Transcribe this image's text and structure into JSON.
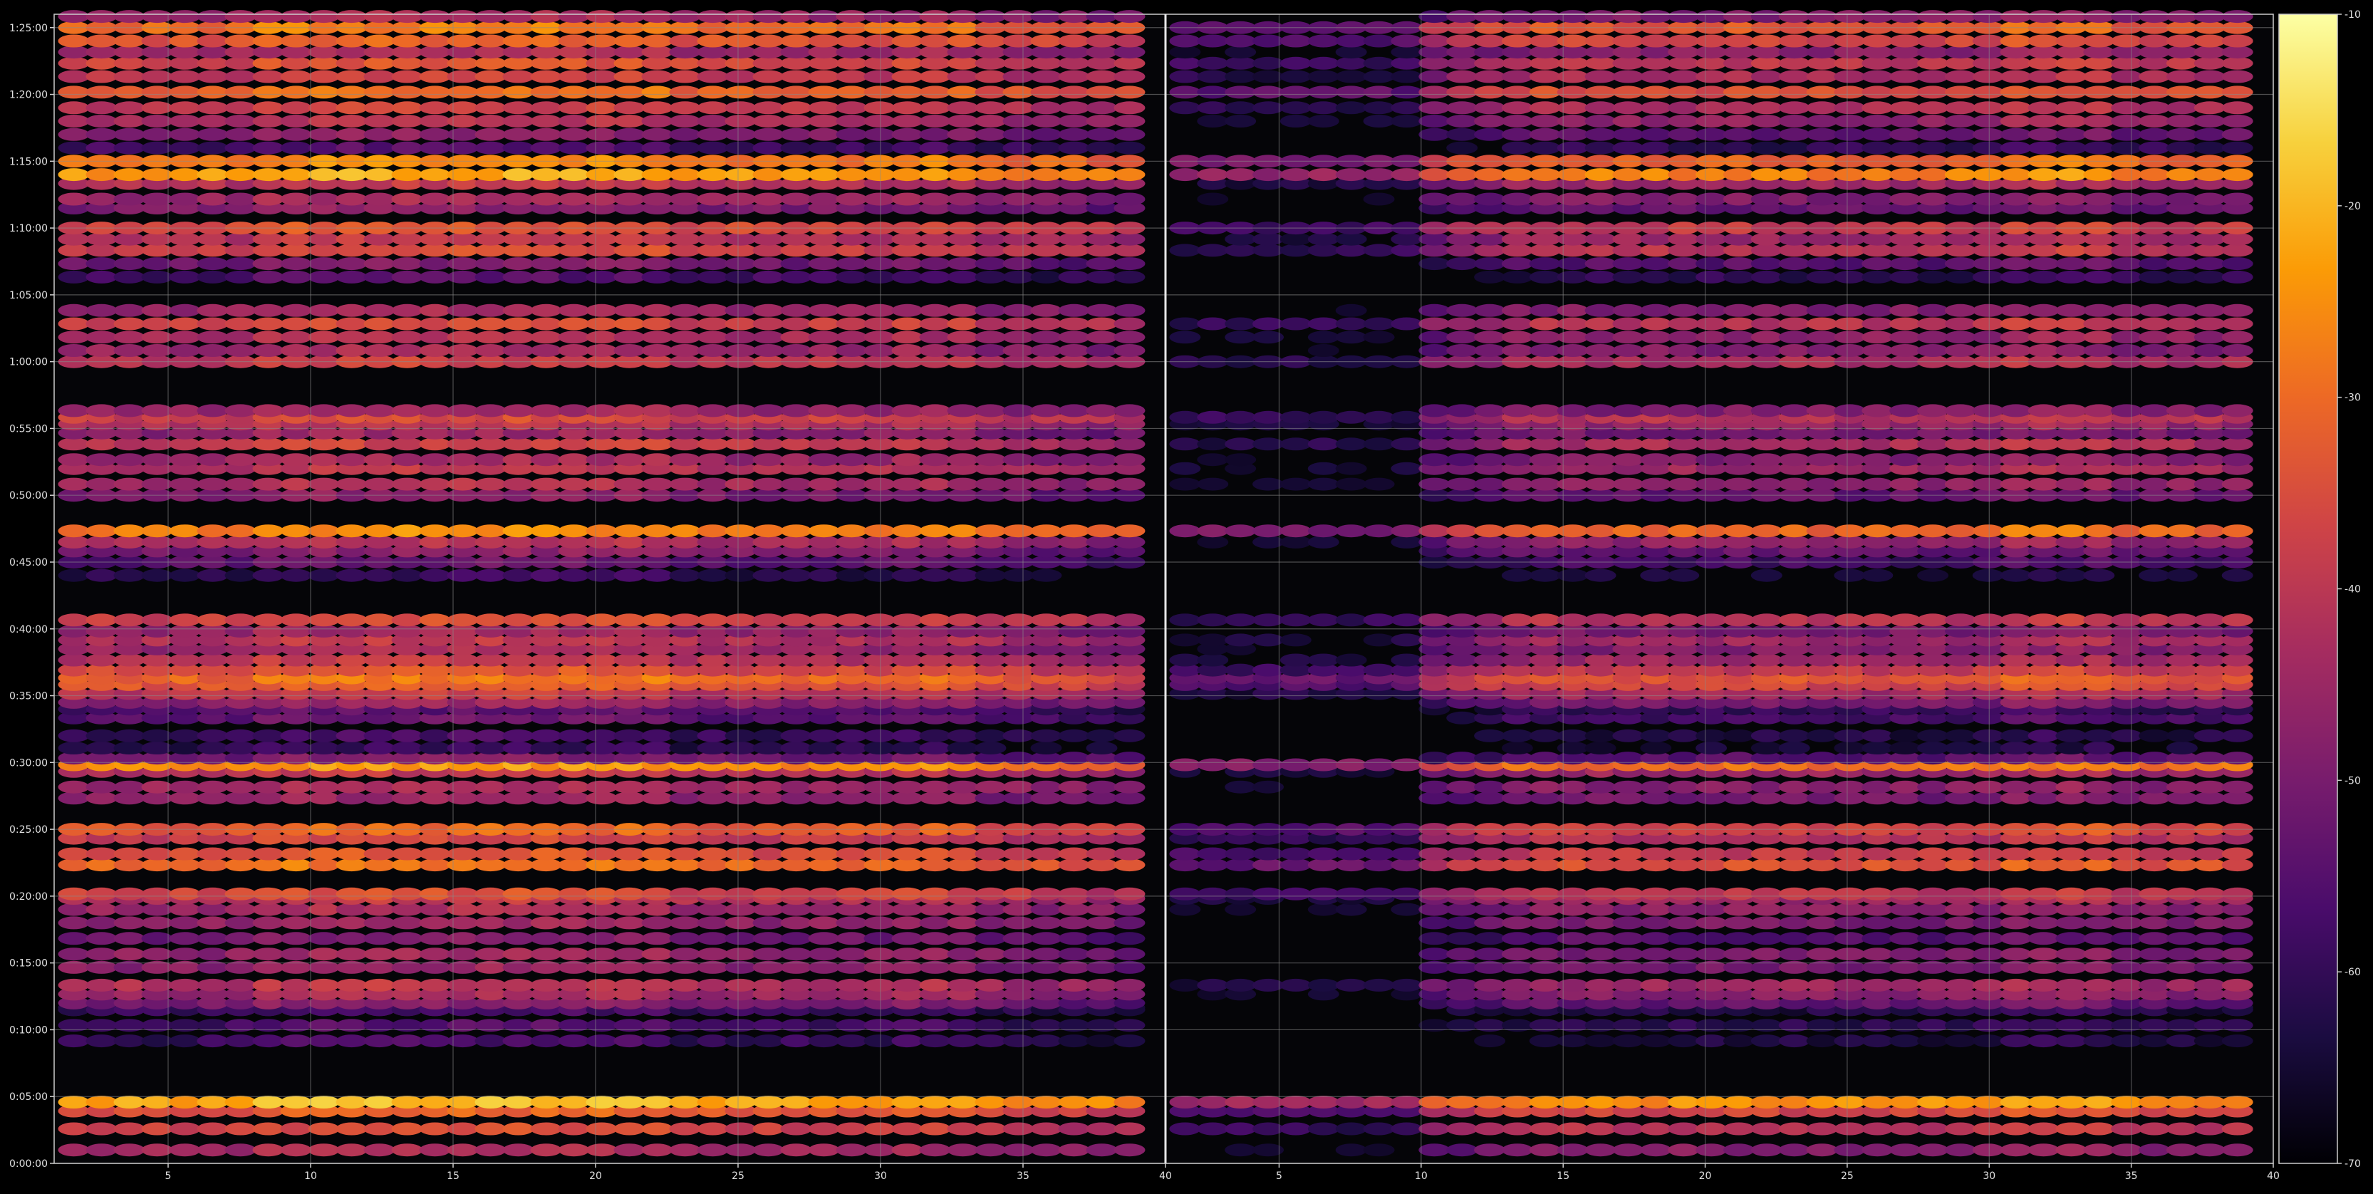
{
  "chart_data": {
    "type": "heatmap",
    "title": "",
    "xlabel": "",
    "ylabel": "",
    "panels": [
      {
        "name": "",
        "xlim": [
          1,
          40
        ],
        "xticks": [
          5,
          10,
          15,
          20,
          25,
          30,
          35,
          40
        ]
      },
      {
        "name": "",
        "xlim": [
          1,
          40
        ],
        "xticks": [
          5,
          10,
          15,
          20,
          25,
          30,
          35,
          40
        ]
      }
    ],
    "ylim_seconds": [
      0,
      5160
    ],
    "yticks": [
      {
        "label": "0:00:00",
        "seconds": 0
      },
      {
        "label": "0:05:00",
        "seconds": 300
      },
      {
        "label": "0:10:00",
        "seconds": 600
      },
      {
        "label": "0:15:00",
        "seconds": 900
      },
      {
        "label": "0:20:00",
        "seconds": 1200
      },
      {
        "label": "0:25:00",
        "seconds": 1500
      },
      {
        "label": "0:30:00",
        "seconds": 1800
      },
      {
        "label": "0:35:00",
        "seconds": 2100
      },
      {
        "label": "0:40:00",
        "seconds": 2400
      },
      {
        "label": "0:45:00",
        "seconds": 2700
      },
      {
        "label": "0:50:00",
        "seconds": 3000
      },
      {
        "label": "0:55:00",
        "seconds": 3300
      },
      {
        "label": "1:00:00",
        "seconds": 3600
      },
      {
        "label": "1:05:00",
        "seconds": 3900
      },
      {
        "label": "1:10:00",
        "seconds": 4200
      },
      {
        "label": "1:15:00",
        "seconds": 4500
      },
      {
        "label": "1:20:00",
        "seconds": 4800
      },
      {
        "label": "1:25:00",
        "seconds": 5100
      }
    ],
    "colorbar": {
      "min": -70,
      "max": -10,
      "ticks": [
        -70,
        -60,
        -50,
        -40,
        -30,
        -20,
        -10
      ],
      "colormap": "inferno",
      "stops": [
        "#000004",
        "#1b0c41",
        "#4a0c6b",
        "#781c6d",
        "#a52c60",
        "#cf4446",
        "#ed6925",
        "#fb9b06",
        "#f7d13d",
        "#fcffa4"
      ]
    },
    "grid": true,
    "row_bands": [
      {
        "t": 60,
        "v": -45
      },
      {
        "t": 155,
        "v": -38
      },
      {
        "t": 235,
        "v": -34
      },
      {
        "t": 275,
        "v": -22
      },
      {
        "t": 550,
        "v": -60
      },
      {
        "t": 620,
        "v": -58
      },
      {
        "t": 690,
        "v": -56
      },
      {
        "t": 700,
        "v": -60
      },
      {
        "t": 690,
        "v": -60
      },
      {
        "t": 720,
        "v": -50
      },
      {
        "t": 760,
        "v": -45
      },
      {
        "t": 800,
        "v": -42
      },
      {
        "t": 880,
        "v": -48
      },
      {
        "t": 940,
        "v": -47
      },
      {
        "t": 1010,
        "v": -52
      },
      {
        "t": 1080,
        "v": -47
      },
      {
        "t": 1140,
        "v": -45
      },
      {
        "t": 1190,
        "v": -42
      },
      {
        "t": 1210,
        "v": -37
      },
      {
        "t": 1340,
        "v": -31
      },
      {
        "t": 1390,
        "v": -36
      },
      {
        "t": 1460,
        "v": -39
      },
      {
        "t": 1500,
        "v": -33
      },
      {
        "t": 1640,
        "v": -48
      },
      {
        "t": 1690,
        "v": -45
      },
      {
        "t": 1760,
        "v": -42
      },
      {
        "t": 1790,
        "v": -26
      },
      {
        "t": 1820,
        "v": -52
      },
      {
        "t": 1865,
        "v": -62
      },
      {
        "t": 1920,
        "v": -60
      },
      {
        "t": 2000,
        "v": -55
      },
      {
        "t": 2040,
        "v": -57
      },
      {
        "t": 2070,
        "v": -48
      },
      {
        "t": 2110,
        "v": -41
      },
      {
        "t": 2150,
        "v": -34
      },
      {
        "t": 2180,
        "v": -31
      },
      {
        "t": 2215,
        "v": -36
      },
      {
        "t": 2260,
        "v": -42
      },
      {
        "t": 2310,
        "v": -46
      },
      {
        "t": 2350,
        "v": -42
      },
      {
        "t": 2390,
        "v": -47
      },
      {
        "t": 2440,
        "v": -38
      },
      {
        "t": 2640,
        "v": -62
      },
      {
        "t": 2700,
        "v": -55
      },
      {
        "t": 2750,
        "v": -50
      },
      {
        "t": 2790,
        "v": -44
      },
      {
        "t": 2840,
        "v": -28
      },
      {
        "t": 3000,
        "v": -50
      },
      {
        "t": 3050,
        "v": -44
      },
      {
        "t": 3120,
        "v": -42
      },
      {
        "t": 3160,
        "v": -46
      },
      {
        "t": 3230,
        "v": -40
      },
      {
        "t": 3280,
        "v": -48
      },
      {
        "t": 3320,
        "v": -43
      },
      {
        "t": 3350,
        "v": -38
      },
      {
        "t": 3380,
        "v": -46
      },
      {
        "t": 3600,
        "v": -40
      },
      {
        "t": 3650,
        "v": -46
      },
      {
        "t": 3710,
        "v": -44
      },
      {
        "t": 3770,
        "v": -38
      },
      {
        "t": 3830,
        "v": -46
      },
      {
        "t": 3980,
        "v": -58
      },
      {
        "t": 4040,
        "v": -52
      },
      {
        "t": 4100,
        "v": -38
      },
      {
        "t": 4150,
        "v": -42
      },
      {
        "t": 4200,
        "v": -36
      },
      {
        "t": 4290,
        "v": -50
      },
      {
        "t": 4330,
        "v": -46
      },
      {
        "t": 4400,
        "v": -42
      },
      {
        "t": 4440,
        "v": -24
      },
      {
        "t": 4500,
        "v": -28
      },
      {
        "t": 4560,
        "v": -58
      },
      {
        "t": 4620,
        "v": -50
      },
      {
        "t": 4680,
        "v": -44
      },
      {
        "t": 4740,
        "v": -40
      },
      {
        "t": 4810,
        "v": -32
      },
      {
        "t": 4880,
        "v": -40
      },
      {
        "t": 4940,
        "v": -37
      },
      {
        "t": 4990,
        "v": -45
      },
      {
        "t": 5040,
        "v": -34
      },
      {
        "t": 5100,
        "v": -30
      },
      {
        "t": 5150,
        "v": -46
      }
    ],
    "column_modifiers": {
      "left_panel": "brightest near x 10-22, dimmer toward x 40",
      "right_panel": "mostly dark for x 1-10, rising from x 12 onward, bright spot near x 32"
    }
  }
}
